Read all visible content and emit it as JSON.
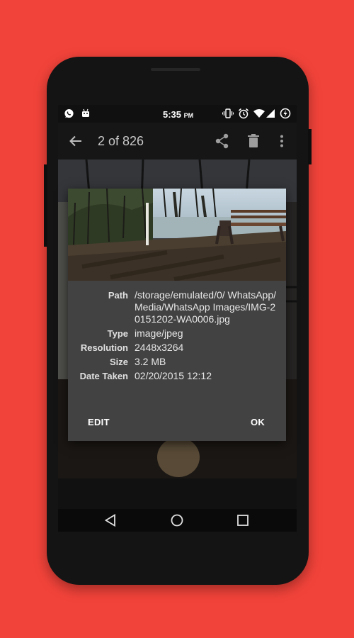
{
  "status_bar": {
    "time": "5:35",
    "ampm": "PM",
    "left_icons": [
      "whatsapp-icon",
      "android-icon"
    ],
    "right_icons": [
      "vibrate-icon",
      "alarm-icon",
      "wifi-icon",
      "signal-icon",
      "battery-charging-icon"
    ]
  },
  "toolbar": {
    "back_icon": "arrow-left-icon",
    "title": "2 of 826",
    "actions": [
      "share-icon",
      "delete-icon",
      "more-vert-icon"
    ]
  },
  "dialog": {
    "properties": [
      {
        "label": "Path",
        "value": "/storage/emulated/0/ WhatsApp/Media/WhatsApp Images/IMG-20151202-WA0006.jpg"
      },
      {
        "label": "Type",
        "value": "image/jpeg"
      },
      {
        "label": "Resolution",
        "value": "2448x3264"
      },
      {
        "label": "Size",
        "value": "3.2 MB"
      },
      {
        "label": "Date Taken",
        "value": "02/20/2015 12:12"
      }
    ],
    "edit_label": "EDIT",
    "ok_label": "OK"
  },
  "nav_bar": {
    "icons": [
      "back-triangle-icon",
      "home-circle-icon",
      "recents-square-icon"
    ]
  },
  "colors": {
    "background": "#f2433a",
    "dialog": "#424242",
    "phone": "#141414"
  }
}
